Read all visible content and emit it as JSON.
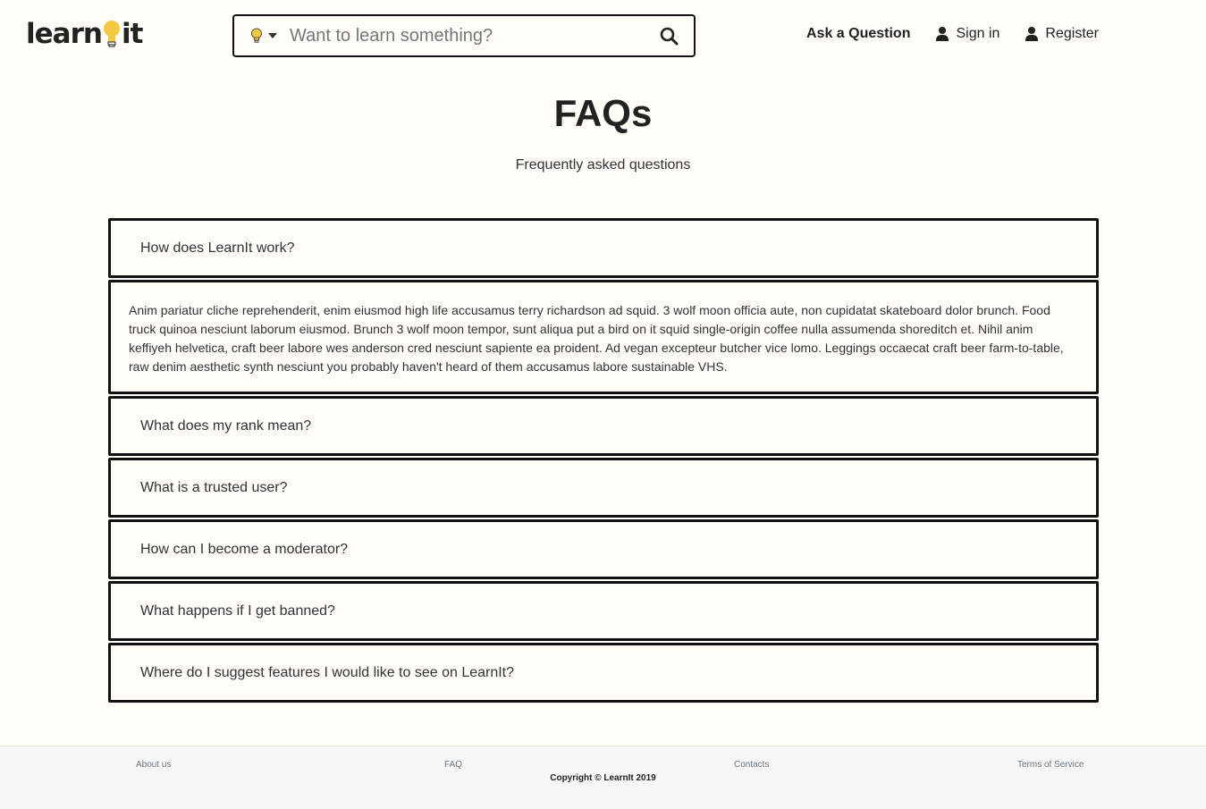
{
  "header": {
    "logo_text_before": "learn",
    "logo_text_after": "it",
    "search_placeholder": "Want to learn something?",
    "nav": {
      "ask": "Ask a Question",
      "signin": "Sign in",
      "register": "Register"
    }
  },
  "page": {
    "title": "FAQs",
    "subtitle": "Frequently asked questions"
  },
  "faq": {
    "items": [
      {
        "question": "How does LearnIt work?",
        "answer": "Anim pariatur cliche reprehenderit, enim eiusmod high life accusamus terry richardson ad squid. 3 wolf moon officia aute, non cupidatat skateboard dolor brunch. Food truck quinoa nesciunt laborum eiusmod. Brunch 3 wolf moon tempor, sunt aliqua put a bird on it squid single-origin coffee nulla assumenda shoreditch et. Nihil anim keffiyeh helvetica, craft beer labore wes anderson cred nesciunt sapiente ea proident. Ad vegan excepteur butcher vice lomo. Leggings occaecat craft beer farm-to-table, raw denim aesthetic synth nesciunt you probably haven't heard of them accusamus labore sustainable VHS."
      },
      {
        "question": "What does my rank mean?"
      },
      {
        "question": "What is a trusted user?"
      },
      {
        "question": "How can I become a moderator?"
      },
      {
        "question": "What happens if I get banned?"
      },
      {
        "question": "Where do I suggest features I would like to see on LearnIt?"
      }
    ]
  },
  "footer": {
    "about": "About us",
    "faq": "FAQ",
    "contacts": "Contacts",
    "terms": "Terms of Service",
    "copyright": "Copyright © LearnIt 2019"
  },
  "colors": {
    "background": "#fefdf8",
    "bulb": "#f5c842",
    "border": "#111111"
  },
  "icons": {
    "category": "lightbulb-icon",
    "dropdown": "caret-down-icon",
    "search": "magnifier-icon",
    "user": "user-icon"
  }
}
